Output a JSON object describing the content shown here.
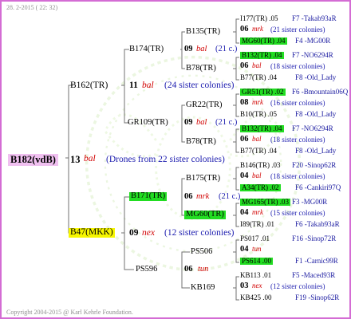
{
  "header": {
    "date": "28. 2-2015 ( 22: 32)"
  },
  "footer": {
    "copyright": "Copyright 2004-2015 @ Karl Kehrle Foundation."
  },
  "root": {
    "name": "B182(vdB)",
    "num": "13",
    "race": "bal",
    "note": "(Drones from 22 sister colonies)"
  },
  "gen1": [
    {
      "name": "B162(TR)",
      "num": "11",
      "race": "bal",
      "note": "(24 sister colonies)"
    },
    {
      "name": "B47(MKK)",
      "num": "09",
      "race": "nex",
      "note": "(12 sister colonies)"
    }
  ],
  "gen2": [
    {
      "name": "B174(TR)",
      "num": "09",
      "race": "bal",
      "note": "(21 c.)"
    },
    {
      "name": "GR109(TR)",
      "num": "09",
      "race": "bal",
      "note": "(21 c.)"
    },
    {
      "name": "B171(TR)",
      "num": "06",
      "race": "mrk",
      "note": "(21 c.)"
    },
    {
      "name": "PS596",
      "num": "06",
      "race": "tun"
    }
  ],
  "gen3": [
    "B135(TR)",
    "B78(TR)",
    "GR22(TR)",
    "B78(TR)",
    "B175(TR)",
    "MG60(TR)",
    "PS506",
    "KB169"
  ],
  "gen4": [
    {
      "top": "I177(TR) .05",
      "topr": "F7 -Takab93aR",
      "mid": "06",
      "race": "mrk",
      "note": "(21 sister colonies)",
      "bot": "MG60(TR) .04",
      "botr": "F4 -MG00R",
      "botGreen": true
    },
    {
      "top": "B132(TR) .04",
      "topr": "F7 -NO6294R",
      "mid": "06",
      "race": "bal",
      "note": "(18 sister colonies)",
      "bot": "B77(TR) .04",
      "botr": "F8 -Old_Lady",
      "topGreen": true
    },
    {
      "top": "GR51(TR) .02",
      "topr": "F6 -Bmountain06Q",
      "mid": "08",
      "race": "mrk",
      "note": "(16 sister colonies)",
      "bot": "B10(TR) .05",
      "botr": "F8 -Old_Lady",
      "topGreen": true
    },
    {
      "top": "B132(TR) .04",
      "topr": "F7 -NO6294R",
      "mid": "06",
      "race": "bal",
      "note": "(18 sister colonies)",
      "bot": "B77(TR) .04",
      "botr": "F8 -Old_Lady",
      "topGreen": true
    },
    {
      "top": "B146(TR) .03",
      "topr": "F20 -Sinop62R",
      "mid": "04",
      "race": "bal",
      "note": "(18 sister colonies)",
      "bot": "A34(TR) .02",
      "botr": "F6 -Cankiri97Q",
      "botGreen": true
    },
    {
      "top": "MG165(TR) .03",
      "topr": "F3 -MG00R",
      "mid": "04",
      "race": "mrk",
      "note": "(15 sister colonies)",
      "bot": "I89(TR) .01",
      "botr": "F6 -Takab93aR",
      "topGreen": true
    },
    {
      "top": "PS017 .01",
      "topr": "F16 -Sinop72R",
      "mid": "04",
      "race": "tun",
      "note": "",
      "bot": "PS614 .00",
      "botr": "F1 -Carnic99R",
      "botGreen": true
    },
    {
      "top": "KB113 .01",
      "topr": "F5 -Maced93R",
      "mid": "03",
      "race": "nex",
      "note": "(12 sister colonies)",
      "bot": "KB425 .00",
      "botr": "F19 -Sinop62R"
    }
  ]
}
